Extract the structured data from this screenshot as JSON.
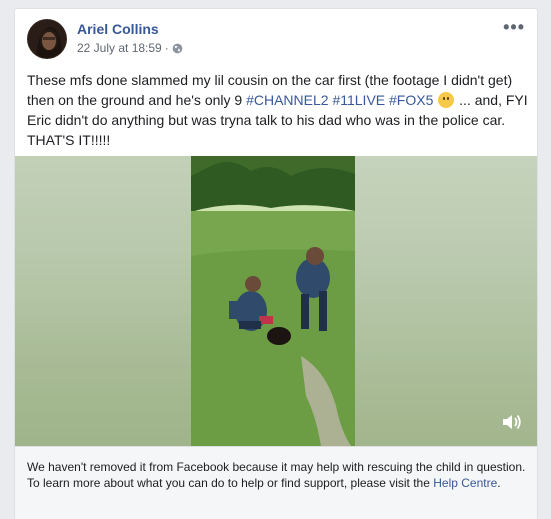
{
  "post": {
    "author": "Ariel Collins",
    "timestamp": "22 July at 18:59",
    "separator": "·",
    "privacy_icon": "globe-icon",
    "more_icon": "more-options-icon",
    "more_label": "•••",
    "text_part1": "These mfs done slammed my lil cousin on the car first (the footage I didn't get) then on the ground and he's only 9 ",
    "hashtags": [
      "#CHANNEL2",
      "#11LIVE",
      "#FOX5"
    ],
    "text_part2": " ... and, FYI Eric didn't do anything but was tryna talk to his dad who was in the police car. THAT'S IT!!!!!"
  },
  "media": {
    "sound_icon": "speaker-icon"
  },
  "notice": {
    "text": "We haven't removed it from Facebook because it may help with rescuing the child in question. To learn more about what you can do to help or find support, please visit the ",
    "link_label": "Help Centre",
    "end": "."
  },
  "colors": {
    "link": "#385898",
    "meta": "#616770",
    "notice_bg": "#f5f6f7"
  }
}
